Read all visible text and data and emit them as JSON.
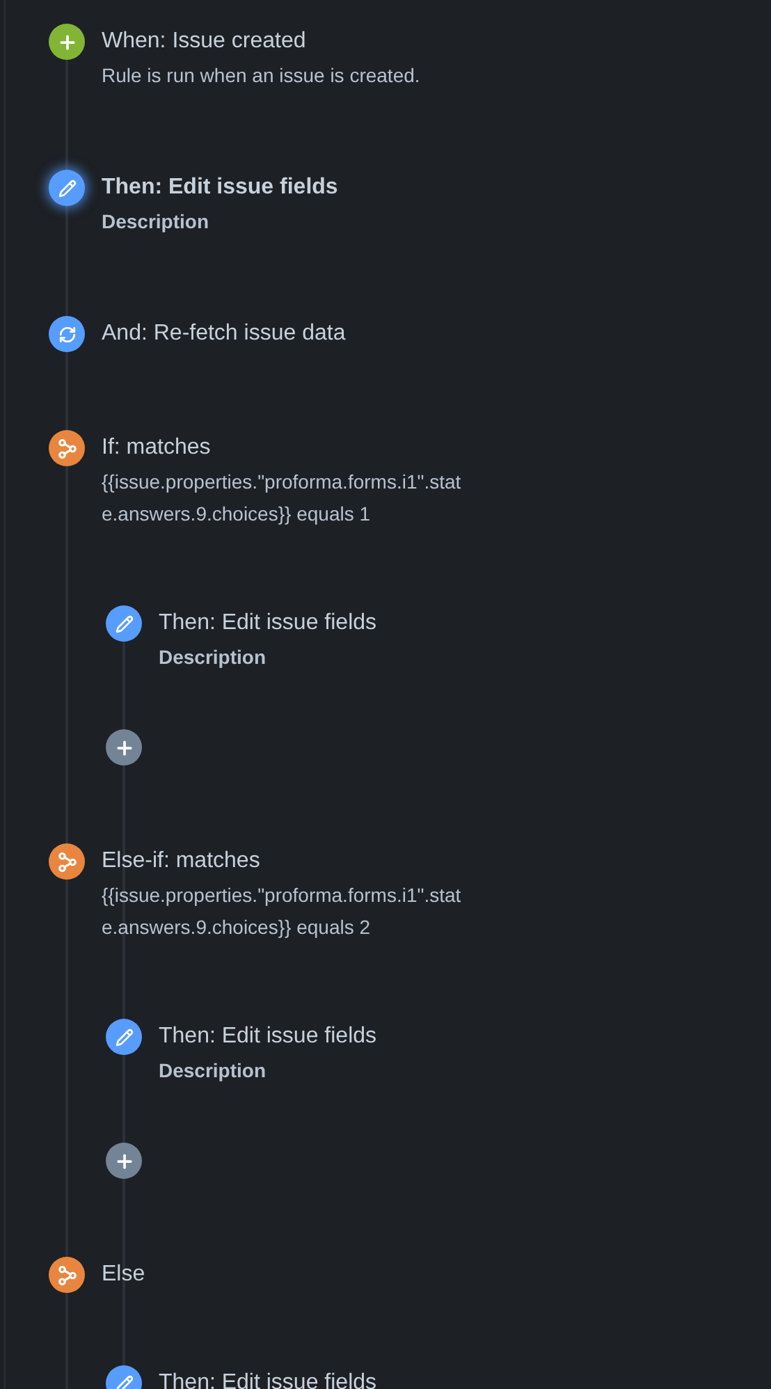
{
  "rule": {
    "steps": [
      {
        "kind": "trigger",
        "title": "When: Issue created",
        "detail": "Rule is run when an issue is created.",
        "selected": false
      },
      {
        "kind": "edit",
        "title": "Then: Edit issue fields",
        "detail": "Description",
        "selected": true
      },
      {
        "kind": "refetch",
        "title": "And: Re-fetch issue data",
        "selected": false
      },
      {
        "kind": "branch",
        "title": "If: matches",
        "detail": "{{issue.properties.\"proforma.forms.i1\".state.answers.9.choices}} equals 1",
        "selected": false,
        "children": [
          {
            "kind": "edit",
            "title": "Then: Edit issue fields",
            "detail": "Description",
            "selected": false
          },
          {
            "kind": "add"
          }
        ]
      },
      {
        "kind": "branch",
        "title": "Else-if: matches",
        "detail": "{{issue.properties.\"proforma.forms.i1\".state.answers.9.choices}} equals 2",
        "selected": false,
        "children": [
          {
            "kind": "edit",
            "title": "Then: Edit issue fields",
            "detail": "Description",
            "selected": false
          },
          {
            "kind": "add"
          }
        ]
      },
      {
        "kind": "branch",
        "title": "Else",
        "selected": false,
        "children": [
          {
            "kind": "edit",
            "title": "Then: Edit issue fields",
            "selected": false
          }
        ]
      }
    ]
  }
}
